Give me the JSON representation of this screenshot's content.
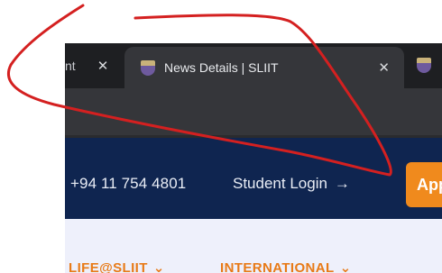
{
  "browser": {
    "tabs": [
      {
        "label": "nt",
        "close": "✕"
      },
      {
        "label": "News Details | SLIIT",
        "close": "✕",
        "active": true
      }
    ]
  },
  "site": {
    "topbar": {
      "phone": "+94 11 754 4801",
      "student_login": "Student Login",
      "student_login_arrow": "→",
      "apply_button": "App"
    },
    "nav": [
      {
        "label": "LIFE@SLIIT",
        "chevron": "⌄"
      },
      {
        "label": "INTERNATIONAL",
        "chevron": "⌄"
      }
    ]
  },
  "colors": {
    "annotation": "#d42020",
    "brand_navy": "#0f2550",
    "brand_orange": "#f08a1d"
  }
}
